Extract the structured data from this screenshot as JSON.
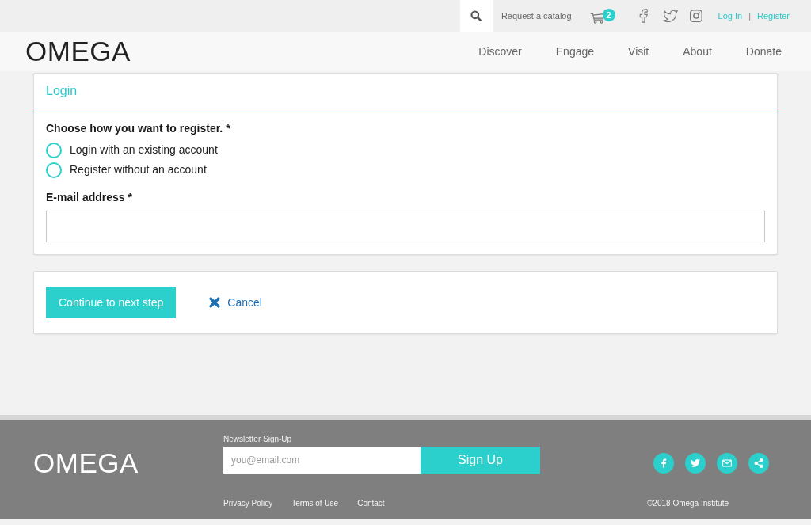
{
  "utility_bar": {
    "catalog_link": "Request a catalog",
    "cart_count": "2",
    "auth_links": [
      "Log In",
      "Register"
    ],
    "separator": "|"
  },
  "header": {
    "logo": "OMEGA",
    "nav": [
      "Discover",
      "Engage",
      "Visit",
      "About",
      "Donate"
    ]
  },
  "login_card": {
    "title": "Login",
    "question": "Choose how you want to register. *",
    "options": [
      {
        "label": "Login with an existing account",
        "selected": false
      },
      {
        "label": "Register without an account",
        "selected": false
      }
    ],
    "email_label": "E-mail address *"
  },
  "actions": {
    "continue_button": "Continue to next step",
    "cancel_link": "Cancel"
  },
  "footer": {
    "logo": "OMEGA",
    "newsletter": {
      "label": "Newsletter Sign-Up",
      "placeholder": "you@email.com",
      "button": "Sign Up"
    },
    "links": [
      "Privacy Policy",
      "Terms of Use",
      "Contact"
    ],
    "copyright": "©2018 Omega Institute"
  }
}
